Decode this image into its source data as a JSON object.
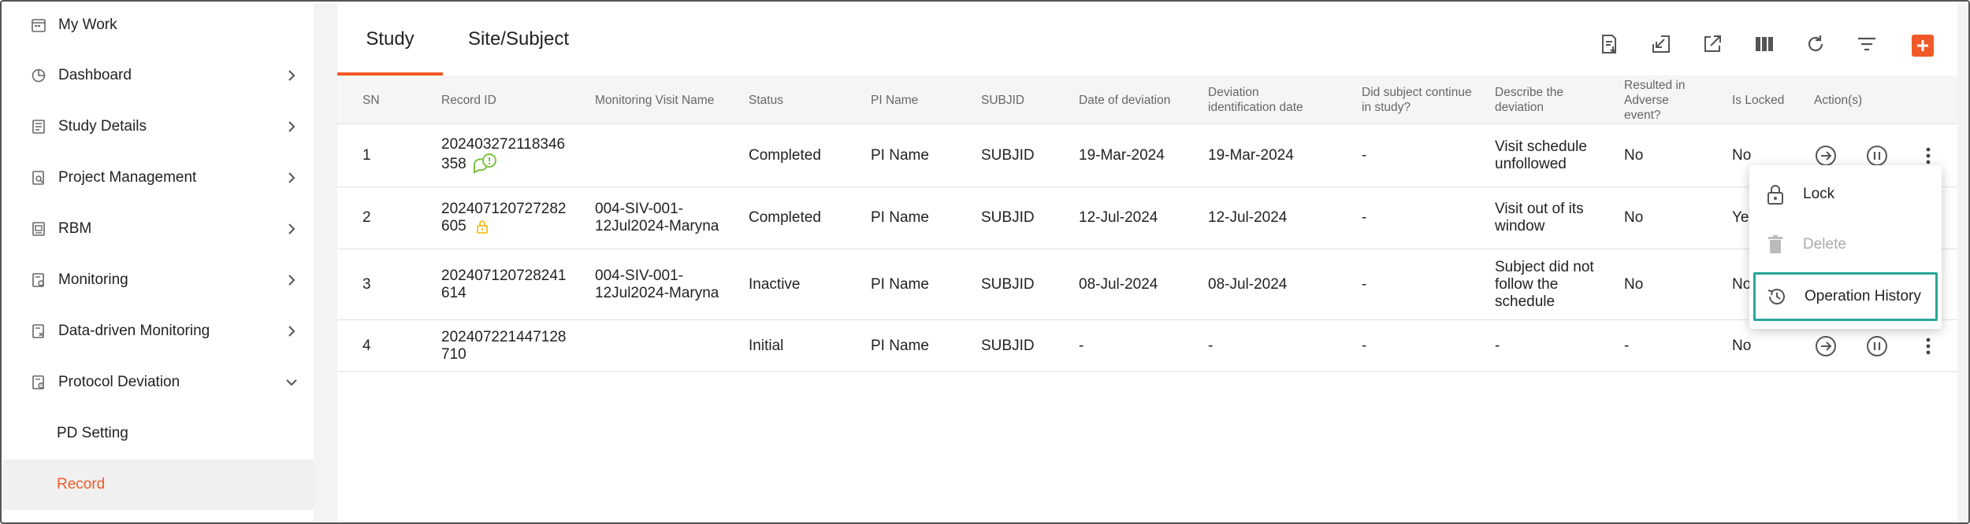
{
  "sidebar": {
    "items": [
      {
        "label": "My Work",
        "icon": "calendar-icon",
        "chevron": "none"
      },
      {
        "label": "Dashboard",
        "icon": "pie-chart-icon",
        "chevron": "right"
      },
      {
        "label": "Study Details",
        "icon": "document-list-icon",
        "chevron": "right"
      },
      {
        "label": "Project Management",
        "icon": "document-search-icon",
        "chevron": "right"
      },
      {
        "label": "RBM",
        "icon": "document-chart-icon",
        "chevron": "right"
      },
      {
        "label": "Monitoring",
        "icon": "document-monitor-icon",
        "chevron": "right"
      },
      {
        "label": "Data-driven Monitoring",
        "icon": "document-data-icon",
        "chevron": "right"
      },
      {
        "label": "Protocol Deviation",
        "icon": "document-deviation-icon",
        "chevron": "down"
      }
    ],
    "sub_items": [
      {
        "label": "PD Setting"
      },
      {
        "label": "Record",
        "active": true
      }
    ]
  },
  "tabs": [
    {
      "label": "Study",
      "active": true
    },
    {
      "label": "Site/Subject",
      "active": false
    }
  ],
  "toolbar": {
    "icons": [
      "export-icon",
      "import-icon",
      "open-external-icon",
      "columns-icon",
      "refresh-icon",
      "filter-icon",
      "add-icon"
    ]
  },
  "table": {
    "headers": {
      "sn": "SN",
      "record_id": "Record ID",
      "visit": "Monitoring Visit Name",
      "status": "Status",
      "pi": "PI Name",
      "subjid": "SUBJID",
      "date_dev": "Date of deviation",
      "dev_id_date": "Deviation identification date",
      "continue": "Did subject continue in study?",
      "describe": "Describe the deviation",
      "adverse": "Resulted in Adverse event?",
      "locked": "Is Locked",
      "actions": "Action(s)"
    },
    "rows": [
      {
        "sn": "1",
        "record_id_1": "202403272118346",
        "record_id_2": "358",
        "visit": "",
        "status": "Completed",
        "pi": "PI Name",
        "subjid": "SUBJID",
        "date_dev": "19-Mar-2024",
        "dev_id_date": "19-Mar-2024",
        "continue": "-",
        "describe": "Visit schedule unfollowed",
        "adverse": "No",
        "locked": "No",
        "badge": "comment-alert-icon"
      },
      {
        "sn": "2",
        "record_id_1": "202407120727282",
        "record_id_2": "605",
        "visit": "004-SIV-001-12Jul2024-Maryna",
        "status": "Completed",
        "pi": "PI Name",
        "subjid": "SUBJID",
        "date_dev": "12-Jul-2024",
        "dev_id_date": "12-Jul-2024",
        "continue": "-",
        "describe": "Visit out of its window",
        "adverse": "No",
        "locked": "Ye",
        "badge": "lock-icon"
      },
      {
        "sn": "3",
        "record_id_1": "202407120728241",
        "record_id_2": "614",
        "visit": "004-SIV-001-12Jul2024-Maryna",
        "status": "Inactive",
        "pi": "PI Name",
        "subjid": "SUBJID",
        "date_dev": "08-Jul-2024",
        "dev_id_date": "08-Jul-2024",
        "continue": "-",
        "describe": "Subject did not follow the schedule",
        "adverse": "No",
        "locked": "No",
        "badge": ""
      },
      {
        "sn": "4",
        "record_id_1": "202407221447128",
        "record_id_2": "710",
        "visit": "",
        "status": "Initial",
        "pi": "PI Name",
        "subjid": "SUBJID",
        "date_dev": "-",
        "dev_id_date": "-",
        "continue": "-",
        "describe": "-",
        "adverse": "-",
        "locked": "No",
        "badge": ""
      }
    ]
  },
  "row_menu": {
    "items": [
      {
        "label": "Lock",
        "icon": "lock-icon",
        "disabled": false
      },
      {
        "label": "Delete",
        "icon": "trash-icon",
        "disabled": true
      },
      {
        "label": "Operation History",
        "icon": "history-icon",
        "disabled": false,
        "highlighted": true
      }
    ]
  },
  "colors": {
    "accent": "#f05a28",
    "highlight_border": "#2aa69a",
    "lock_badge": "#f5b400",
    "comment_badge": "#7cc242"
  }
}
